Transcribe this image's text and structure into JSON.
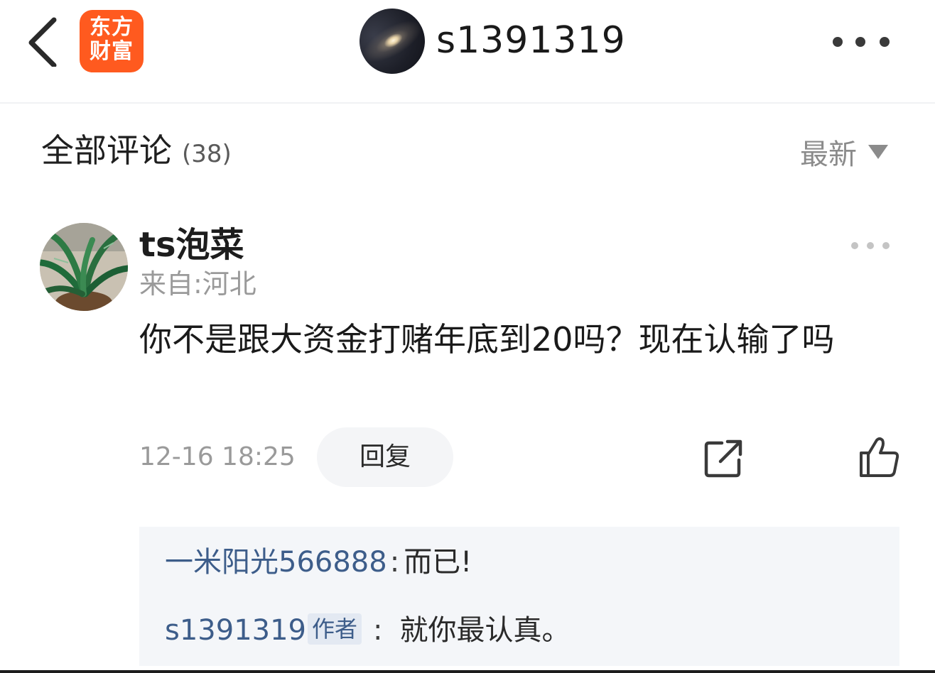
{
  "header": {
    "logo_line1": "东方",
    "logo_line2": "财富",
    "author_name": "s1391319",
    "back_icon": "chevron-left-icon",
    "more_icon": "more-horizontal-icon"
  },
  "comments_section": {
    "title": "全部评论",
    "count": "(38)",
    "sort_label": "最新",
    "sort_icon": "caret-down-icon"
  },
  "comment": {
    "username": "ts泡菜",
    "location": "来自:河北",
    "text": "你不是跟大资金打赌年底到20吗？现在认输了吗",
    "timestamp": "12-16 18:25",
    "reply_label": "回复",
    "share_icon": "share-icon",
    "like_icon": "thumbs-up-icon",
    "more_icon": "more-horizontal-icon"
  },
  "replies": [
    {
      "user": "一米阳光566888",
      "separator": ":",
      "text": "而已!"
    },
    {
      "user": "s1391319",
      "badge": "作者",
      "separator": ":",
      "text": "就你最认真。"
    }
  ],
  "colors": {
    "brand": "#ff5a1f",
    "link_blue": "#3d5d8a",
    "muted": "#9a9a9a",
    "reply_bg": "#f4f6f9"
  }
}
